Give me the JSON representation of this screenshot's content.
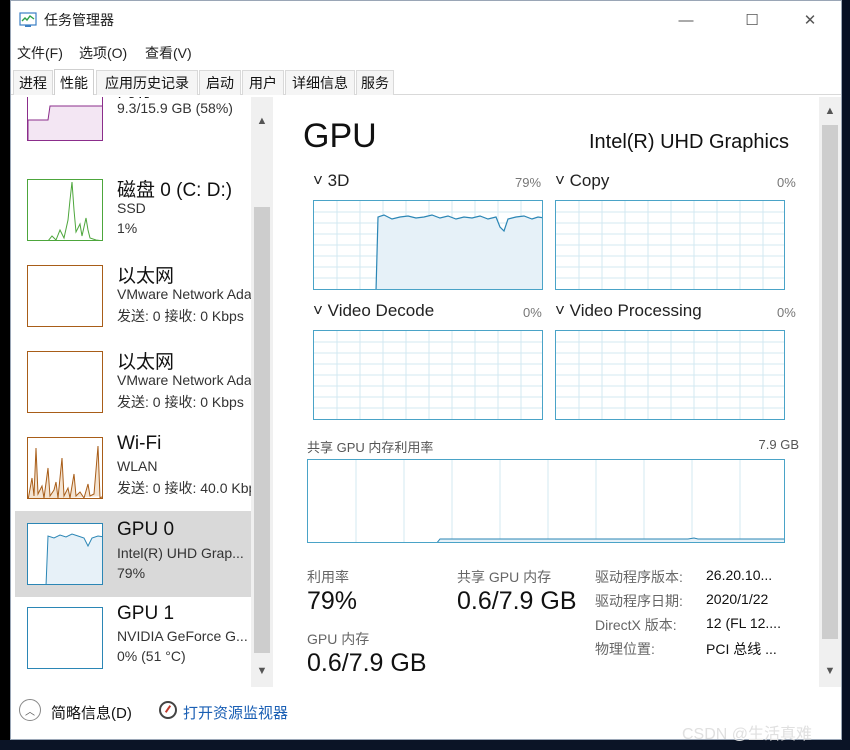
{
  "window": {
    "title": "任务管理器",
    "controls": {
      "minimize": "—",
      "maximize": "☐",
      "close": "✕"
    }
  },
  "menu": [
    "文件(F)",
    "选项(O)",
    "查看(V)"
  ],
  "tabs": [
    {
      "label": "进程",
      "active": false
    },
    {
      "label": "性能",
      "active": true
    },
    {
      "label": "应用历史记录",
      "active": false
    },
    {
      "label": "启动",
      "active": false
    },
    {
      "label": "用户",
      "active": false
    },
    {
      "label": "详细信息",
      "active": false
    },
    {
      "label": "服务",
      "active": false
    }
  ],
  "resources": [
    {
      "name": "内存",
      "line1": "9.3/15.9 GB (58%)",
      "line2": "",
      "color": "#8b2d8b"
    },
    {
      "name": "磁盘 0 (C: D:)",
      "line1": "SSD",
      "line2": "1%",
      "color": "#4da63c"
    },
    {
      "name": "以太网",
      "line1": "VMware Network Adapter",
      "line2": "发送: 0 接收: 0 Kbps",
      "color": "#a85d18"
    },
    {
      "name": "以太网",
      "line1": "VMware Network Adapter",
      "line2": "发送: 0 接收: 0 Kbps",
      "color": "#a85d18"
    },
    {
      "name": "Wi-Fi",
      "line1": "WLAN",
      "line2": "发送: 0 接收: 40.0 Kbps",
      "color": "#a85d18"
    },
    {
      "name": "GPU 0",
      "line1": "Intel(R) UHD Grap...",
      "line2": "79%",
      "color": "#2b86b5",
      "selected": true
    },
    {
      "name": "GPU 1",
      "line1": "NVIDIA GeForce G...",
      "line2": "0% (51 °C)",
      "color": "#2b86b5"
    }
  ],
  "detail": {
    "title": "GPU",
    "model": "Intel(R) UHD Graphics",
    "engines": [
      {
        "label": "3D",
        "percent": "79%"
      },
      {
        "label": "Copy",
        "percent": "0%"
      },
      {
        "label": "Video Decode",
        "percent": "0%"
      },
      {
        "label": "Video Processing",
        "percent": "0%"
      }
    ],
    "shared_label": "共享 GPU 内存利用率",
    "shared_capacity": "7.9 GB",
    "stats": [
      {
        "label": "利用率",
        "value": "79%"
      },
      {
        "label": "共享 GPU 内存",
        "value": "0.6/7.9 GB"
      },
      {
        "label": "GPU 内存",
        "value": "0.6/7.9 GB"
      }
    ],
    "properties": [
      {
        "key": "驱动程序版本:",
        "value": "26.20.10..."
      },
      {
        "key": "驱动程序日期:",
        "value": "2020/1/22"
      },
      {
        "key": "DirectX 版本:",
        "value": "12 (FL 12...."
      },
      {
        "key": "物理位置:",
        "value": "PCI 总线 ..."
      }
    ]
  },
  "footer": {
    "summary": "简略信息(D)",
    "monitor": "打开资源监视器"
  },
  "watermark": "CSDN @生活真难",
  "colors": {
    "graph_border": "#4aa3c7",
    "graph_line": "#2b86b5",
    "selected_bg": "#d9d9d9",
    "link": "#1a5fb4"
  }
}
